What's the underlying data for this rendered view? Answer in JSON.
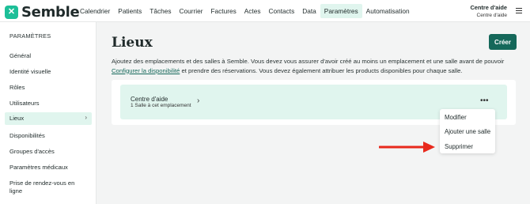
{
  "brand": {
    "name": "Semble",
    "logo_icon": "semble-logo-icon",
    "accent": "#1dbf98"
  },
  "nav": {
    "items": [
      "Calendrier",
      "Patients",
      "Tâches",
      "Courrier",
      "Factures",
      "Actes",
      "Contacts",
      "Data",
      "Paramètres",
      "Automatisation"
    ],
    "active": "Paramètres"
  },
  "account": {
    "name": "Centre d'aide",
    "sub": "Centre d'aide"
  },
  "sidebar": {
    "title": "PARAMÈTRES",
    "items": [
      "Général",
      "Identité visuelle",
      "Rôles",
      "Utilisateurs",
      "Lieux",
      "Disponibilités",
      "Groupes d'accès",
      "Paramètres médicaux",
      "Prise de rendez-vous en ligne"
    ],
    "active": "Lieux"
  },
  "main": {
    "title": "Lieux",
    "create_label": "Créer",
    "description_1": "Ajoutez des emplacements et des salles à Semble. Vous devez vous assurer d'avoir créé au moins un emplacement et une salle avant de pouvoir",
    "link_text": "Configurer la disponibilité",
    "description_2": " et prendre des réservations. Vous devez également attribuer les products disponibles pour chaque salle."
  },
  "location": {
    "name": "Centre d'aide",
    "rooms": "1 Salle à cet emplacement"
  },
  "menu": {
    "items": [
      "Modifier",
      "Ajouter une salle",
      "Supprimer"
    ]
  },
  "colors": {
    "primary": "#15685a",
    "highlight": "#e0f5ee",
    "arrow": "#e8291c"
  }
}
